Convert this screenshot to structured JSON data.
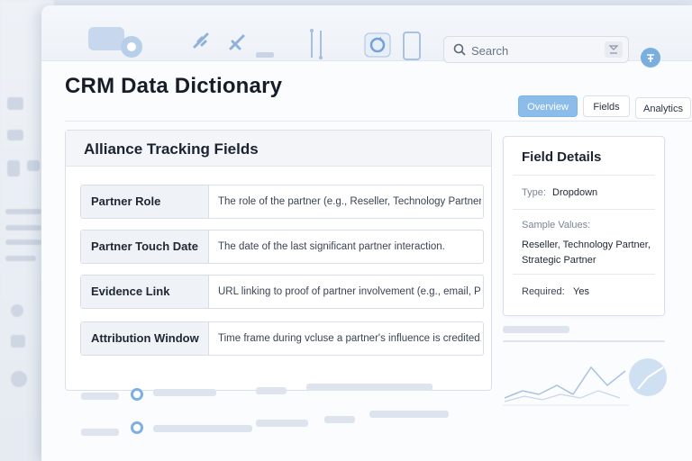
{
  "page": {
    "title": "CRM Data Dictionary"
  },
  "search": {
    "placeholder": "Search"
  },
  "tabs": [
    {
      "label": "Overview",
      "active": true
    },
    {
      "label": "Fields",
      "active": false
    },
    {
      "label": "Analytics",
      "active": false
    }
  ],
  "card": {
    "title": "Alliance Tracking Fields",
    "rows": [
      {
        "name": "Partner Role",
        "description": "The role of the partner (e.g., Reseller, Technology Partner"
      },
      {
        "name": "Partner Touch Date",
        "description": "The date of the last significant partner interaction."
      },
      {
        "name": "Evidence Link",
        "description": "URL linking to proof of partner involvement (e.g., email, PDF)."
      },
      {
        "name": "Attribution Window",
        "description": "Time frame during vcluse a partner's influence is credited."
      }
    ]
  },
  "field_details": {
    "title": "Field Details",
    "type_label": "Type:",
    "type_value": "Dropdown",
    "sample_label": "Sample Values:",
    "sample_values": "Reseller, Technology Partner, Strategic Partner",
    "required_label": "Required:",
    "required_value": "Yes"
  },
  "colors": {
    "accent": "#8bbcea",
    "accent_dark": "#7fb0e2"
  },
  "icons": [
    "search-icon",
    "clear-icon",
    "user-avatar-icon",
    "sync-icon",
    "phone-icon",
    "chart-mini-icon"
  ]
}
